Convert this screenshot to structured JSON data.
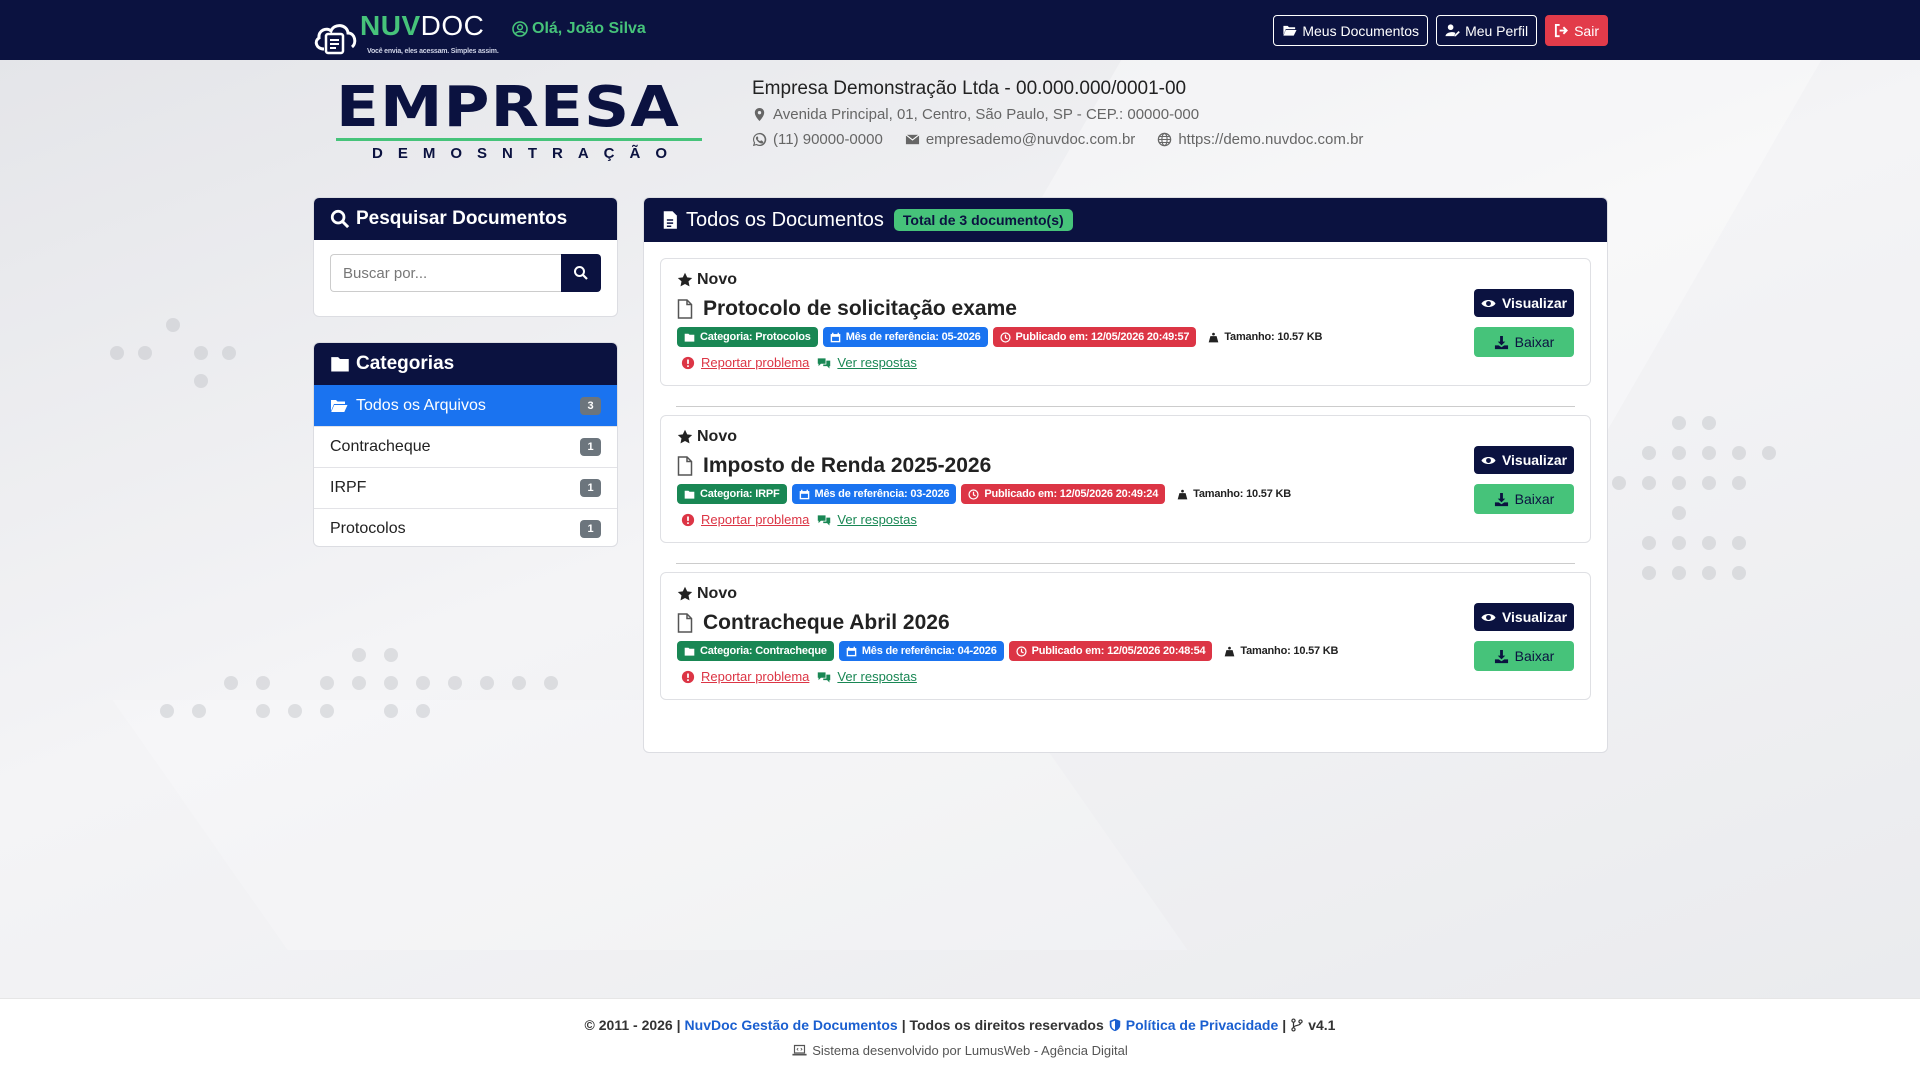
{
  "topbar": {
    "brand_part1": "NUV",
    "brand_part2": "DOC",
    "tagline": "Você envia, eles acessam. Simples assim.",
    "greeting": "Olá, João Silva",
    "buttons": {
      "documents": "Meus Documentos",
      "profile": "Meu Perfil",
      "logout": "Sair"
    }
  },
  "company": {
    "logo_main": "EMPRESA",
    "logo_sub": "DEMOSNTRAÇÃO",
    "name": "Empresa Demonstração Ltda - 00.000.000/0001-00",
    "address": "Avenida Principal, 01, Centro, São Paulo, SP - CEP.: 00000-000",
    "phone": "(11) 90000-0000",
    "email": "empresademo@nuvdoc.com.br",
    "website": "https://demo.nuvdoc.com.br"
  },
  "search": {
    "title": "Pesquisar Documentos",
    "placeholder": "Buscar por..."
  },
  "categories": {
    "title": "Categorias",
    "items": [
      {
        "label": "Todos os Arquivos",
        "count": "3"
      },
      {
        "label": "Contracheque",
        "count": "1"
      },
      {
        "label": "IRPF",
        "count": "1"
      },
      {
        "label": "Protocolos",
        "count": "1"
      }
    ]
  },
  "documents": {
    "title": "Todos os Documentos",
    "total": "Total de 3 documento(s)",
    "items": [
      {
        "new_label": "Novo",
        "title": "Protocolo de solicitação exame",
        "category": "Categoria: Protocolos",
        "reference": "Mês de referência: 05-2026",
        "published": "Publicado em: 12/05/2026 20:49:57",
        "size": "Tamanho: 10.57 KB",
        "report": "Reportar problema",
        "responses": "Ver respostas",
        "view": "Visualizar",
        "download": "Baixar"
      },
      {
        "new_label": "Novo",
        "title": "Imposto de Renda 2025-2026",
        "category": "Categoria: IRPF",
        "reference": "Mês de referência: 03-2026",
        "published": "Publicado em: 12/05/2026 20:49:24",
        "size": "Tamanho: 10.57 KB",
        "report": "Reportar problema",
        "responses": "Ver respostas",
        "view": "Visualizar",
        "download": "Baixar"
      },
      {
        "new_label": "Novo",
        "title": "Contracheque Abril 2026",
        "category": "Categoria: Contracheque",
        "reference": "Mês de referência: 04-2026",
        "published": "Publicado em: 12/05/2026 20:48:54",
        "size": "Tamanho: 10.57 KB",
        "report": "Reportar problema",
        "responses": "Ver respostas",
        "view": "Visualizar",
        "download": "Baixar"
      }
    ]
  },
  "footer": {
    "copyright": "© 2011 - 2026 |",
    "product_link": "NuvDoc Gestão de Documentos",
    "rights": "| Todos os direitos reservados",
    "privacy": "Política de Privacidade",
    "version_sep": "|",
    "version": "v4.1",
    "developer": "Sistema desenvolvido por LumusWeb - Agência Digital"
  },
  "colors": {
    "navy": "#0b1240",
    "green": "#46c37a",
    "blue": "#1a73f0",
    "red": "#dc3545",
    "dark_green": "#198754"
  }
}
